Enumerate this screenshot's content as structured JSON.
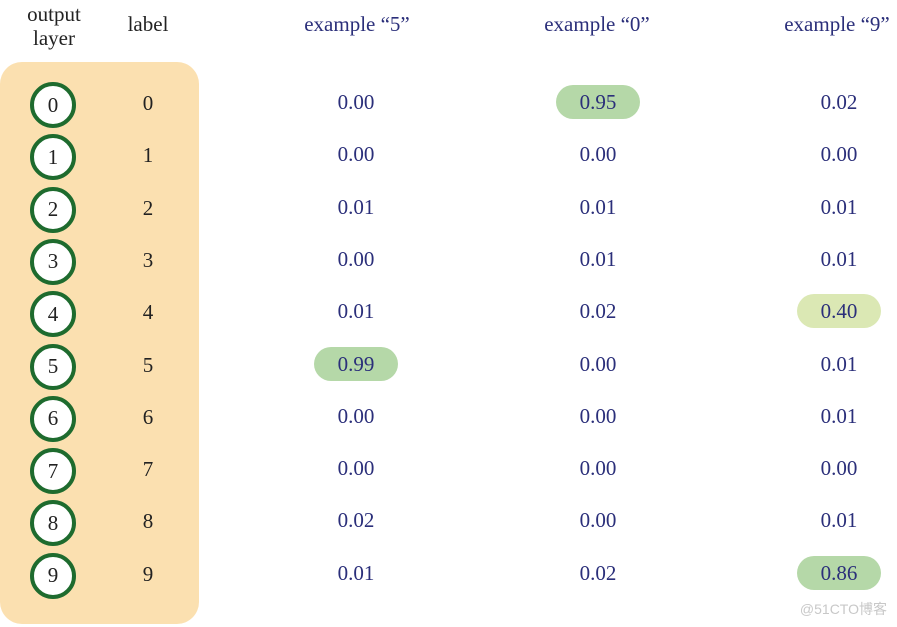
{
  "headers": {
    "output_layer": [
      "output",
      "layer"
    ],
    "label": "label",
    "examples": [
      "example “5”",
      "example “0”",
      "example “9”"
    ]
  },
  "colors": {
    "panel": "#fbe0b0",
    "node_ring": "#1e6b2e",
    "value_text": "#2b2f7a",
    "highlight_strong": "#b5d8a8",
    "highlight_weak": "#dbe8b4"
  },
  "rows": [
    {
      "node": "0",
      "label": "0",
      "values": [
        "0.00",
        "0.95",
        "0.02"
      ],
      "highlight": [
        null,
        "strong",
        null
      ]
    },
    {
      "node": "1",
      "label": "1",
      "values": [
        "0.00",
        "0.00",
        "0.00"
      ],
      "highlight": [
        null,
        null,
        null
      ]
    },
    {
      "node": "2",
      "label": "2",
      "values": [
        "0.01",
        "0.01",
        "0.01"
      ],
      "highlight": [
        null,
        null,
        null
      ]
    },
    {
      "node": "3",
      "label": "3",
      "values": [
        "0.00",
        "0.01",
        "0.01"
      ],
      "highlight": [
        null,
        null,
        null
      ]
    },
    {
      "node": "4",
      "label": "4",
      "values": [
        "0.01",
        "0.02",
        "0.40"
      ],
      "highlight": [
        null,
        null,
        "weak"
      ]
    },
    {
      "node": "5",
      "label": "5",
      "values": [
        "0.99",
        "0.00",
        "0.01"
      ],
      "highlight": [
        "strong",
        null,
        null
      ]
    },
    {
      "node": "6",
      "label": "6",
      "values": [
        "0.00",
        "0.00",
        "0.01"
      ],
      "highlight": [
        null,
        null,
        null
      ]
    },
    {
      "node": "7",
      "label": "7",
      "values": [
        "0.00",
        "0.00",
        "0.00"
      ],
      "highlight": [
        null,
        null,
        null
      ]
    },
    {
      "node": "8",
      "label": "8",
      "values": [
        "0.02",
        "0.00",
        "0.01"
      ],
      "highlight": [
        null,
        null,
        null
      ]
    },
    {
      "node": "9",
      "label": "9",
      "values": [
        "0.01",
        "0.02",
        "0.86"
      ],
      "highlight": [
        null,
        null,
        "strong"
      ]
    }
  ],
  "watermark": "@51CTO博客"
}
